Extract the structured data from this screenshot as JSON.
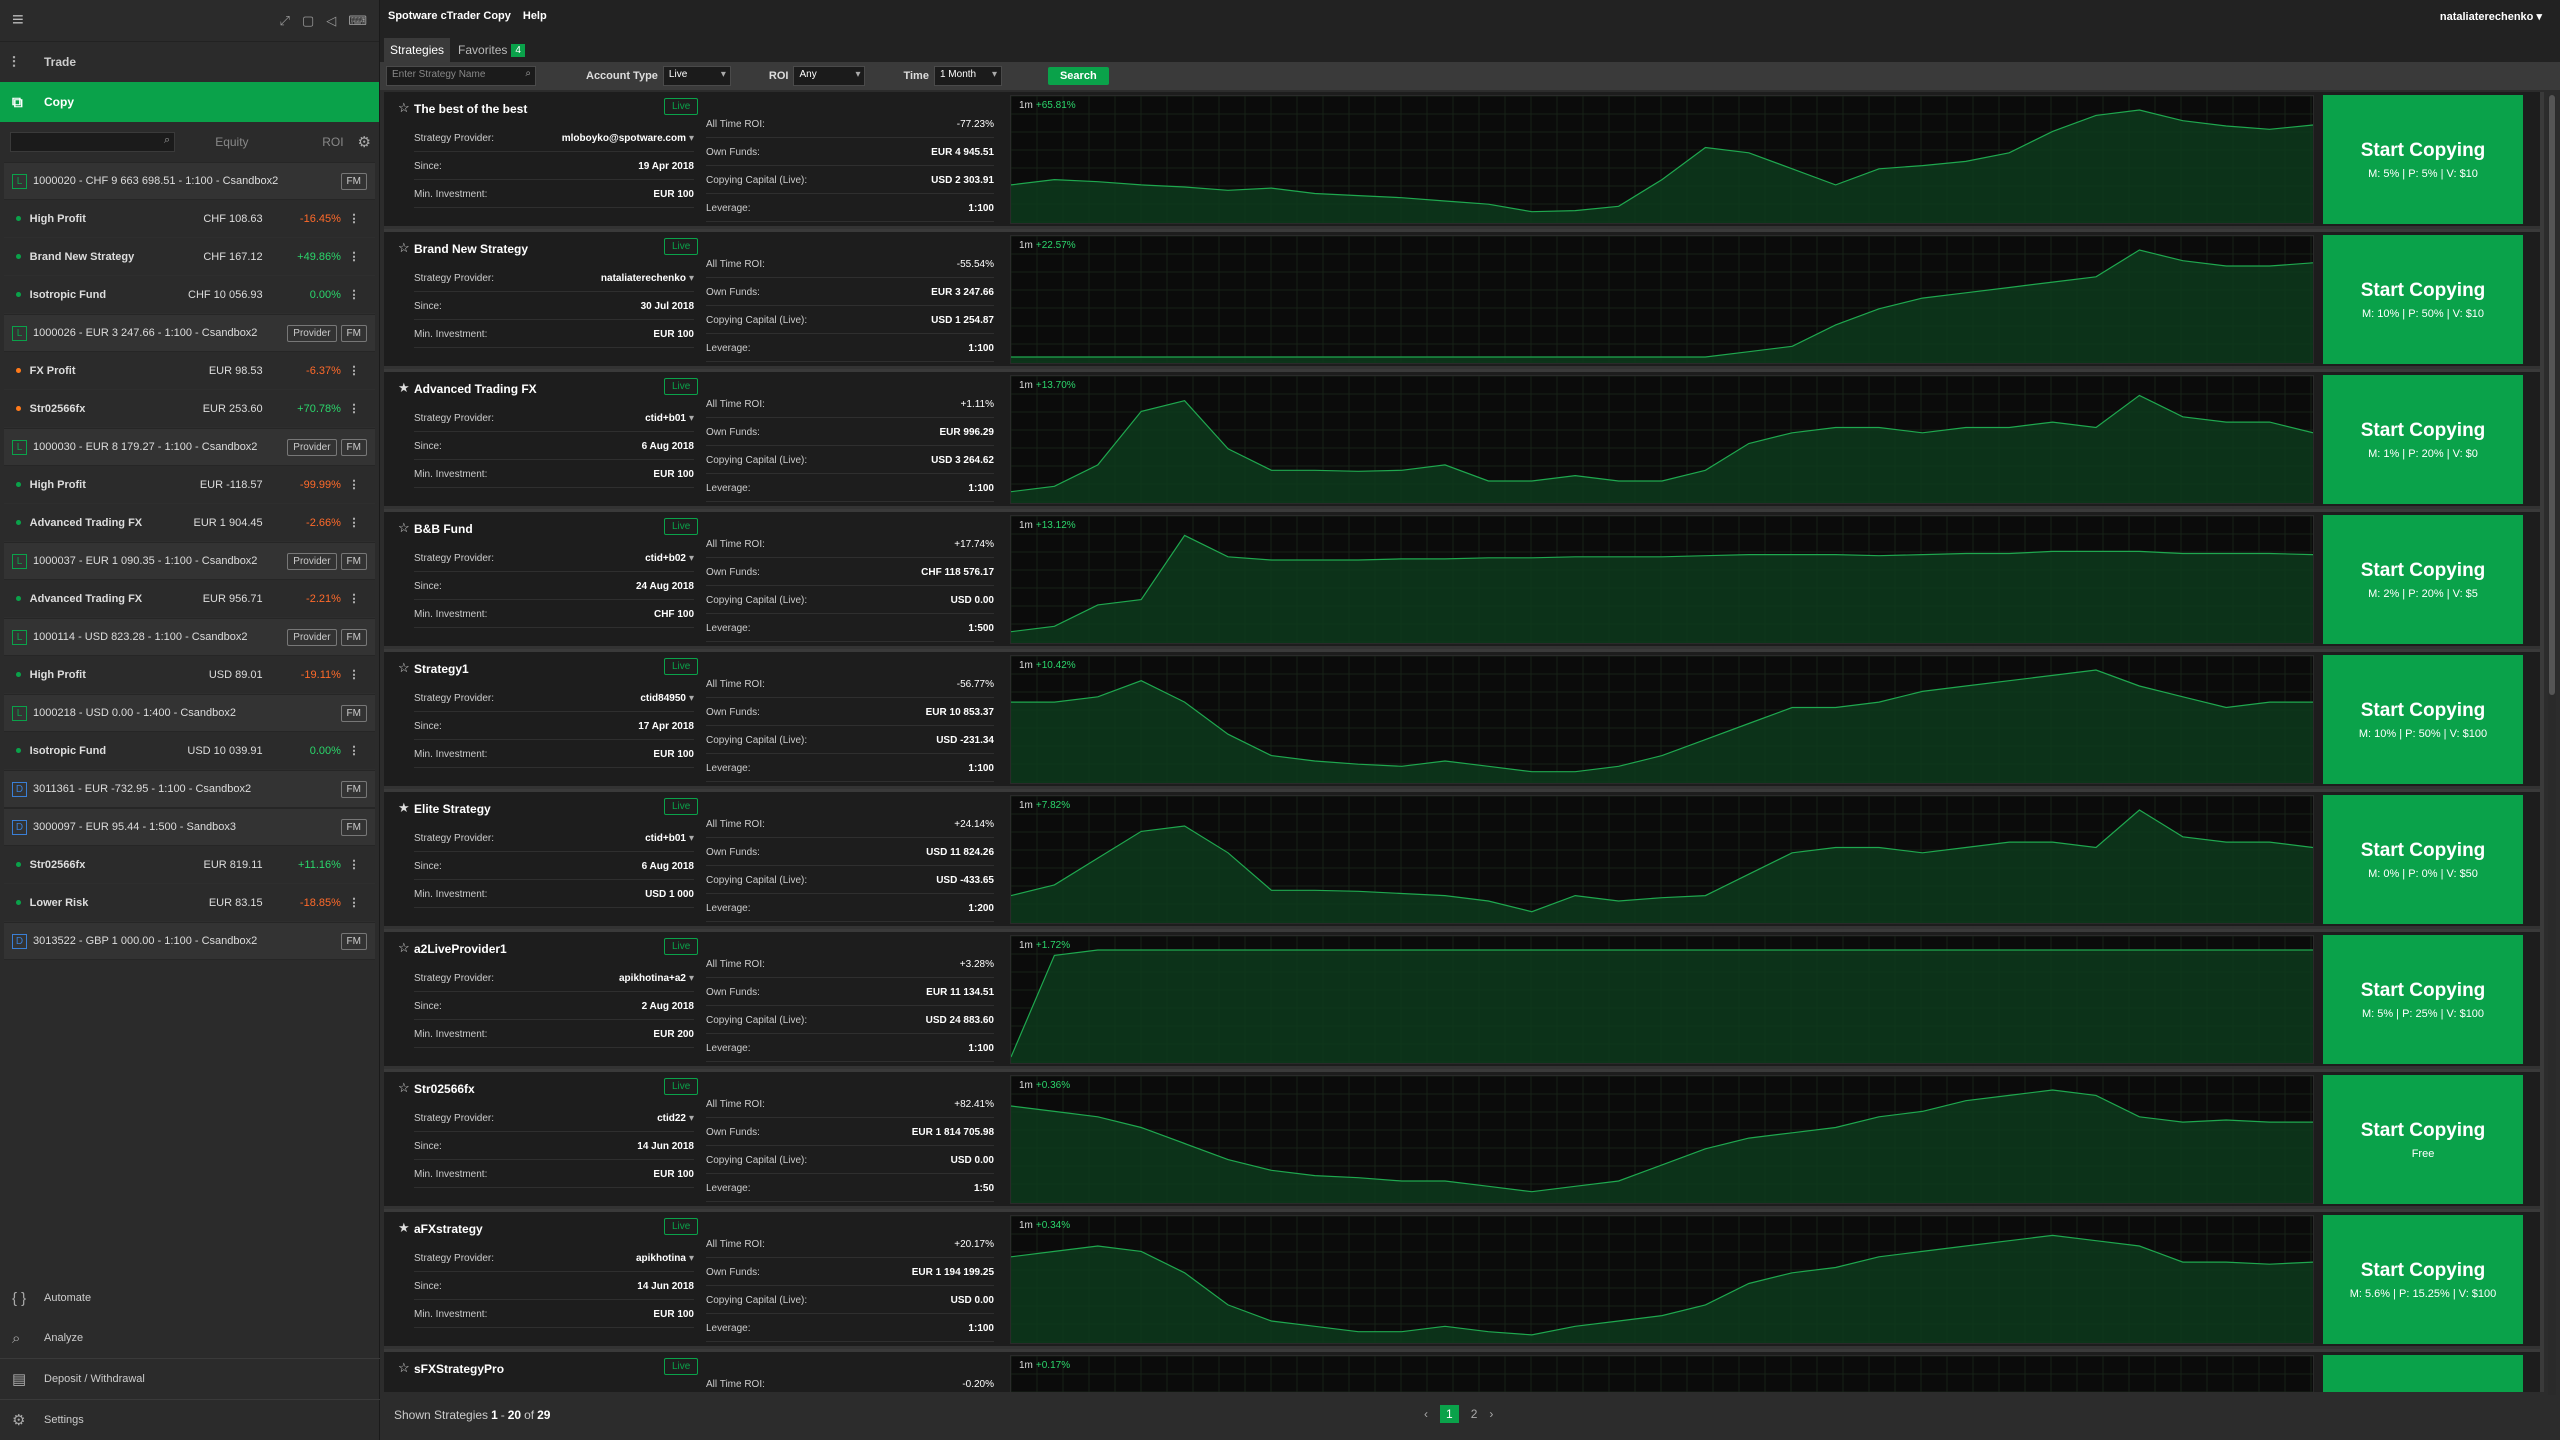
{
  "app": {
    "title": "Spotware cTrader Copy",
    "help": "Help",
    "user": "nataliaterechenko"
  },
  "sidebar": {
    "nav": [
      {
        "label": "Trade",
        "icon": "trade-icon"
      },
      {
        "label": "Copy",
        "icon": "copy-icon"
      }
    ],
    "header": {
      "equity": "Equity",
      "roi": "ROI"
    },
    "items": [
      {
        "kind": "account",
        "badge": "L",
        "label": "1000020 - CHF 9 663 698.51 - 1:100 - Csandbox2",
        "buttons": [
          "FM"
        ]
      },
      {
        "kind": "strategy",
        "dot": "green",
        "name": "High Profit",
        "equity": "CHF 108.63",
        "roi": "-16.45%",
        "roi_sign": "neg"
      },
      {
        "kind": "strategy",
        "dot": "green",
        "name": "Brand New Strategy",
        "equity": "CHF 167.12",
        "roi": "+49.86%",
        "roi_sign": "pos"
      },
      {
        "kind": "strategy",
        "dot": "green",
        "name": "Isotropic Fund",
        "equity": "CHF 10 056.93",
        "roi": "0.00%",
        "roi_sign": "pos"
      },
      {
        "kind": "account",
        "badge": "L",
        "label": "1000026 - EUR 3 247.66 - 1:100 - Csandbox2",
        "buttons": [
          "Provider",
          "FM"
        ]
      },
      {
        "kind": "strategy",
        "dot": "orange",
        "name": "FX Profit",
        "equity": "EUR 98.53",
        "roi": "-6.37%",
        "roi_sign": "neg"
      },
      {
        "kind": "strategy",
        "dot": "orange",
        "name": "Str02566fx",
        "equity": "EUR 253.60",
        "roi": "+70.78%",
        "roi_sign": "pos"
      },
      {
        "kind": "account",
        "badge": "L",
        "label": "1000030 - EUR 8 179.27 - 1:100 - Csandbox2",
        "buttons": [
          "Provider",
          "FM"
        ]
      },
      {
        "kind": "strategy",
        "dot": "green",
        "name": "High Profit",
        "equity": "EUR -118.57",
        "roi": "-99.99%",
        "roi_sign": "neg"
      },
      {
        "kind": "strategy",
        "dot": "green",
        "name": "Advanced Trading FX",
        "equity": "EUR 1 904.45",
        "roi": "-2.66%",
        "roi_sign": "neg"
      },
      {
        "kind": "account",
        "badge": "L",
        "label": "1000037 - EUR 1 090.35 - 1:100 - Csandbox2",
        "buttons": [
          "Provider",
          "FM"
        ]
      },
      {
        "kind": "strategy",
        "dot": "green",
        "name": "Advanced Trading FX",
        "equity": "EUR 956.71",
        "roi": "-2.21%",
        "roi_sign": "neg"
      },
      {
        "kind": "account",
        "badge": "L",
        "label": "1000114 - USD 823.28 - 1:100 - Csandbox2",
        "buttons": [
          "Provider",
          "FM"
        ]
      },
      {
        "kind": "strategy",
        "dot": "green",
        "name": "High Profit",
        "equity": "USD 89.01",
        "roi": "-19.11%",
        "roi_sign": "neg"
      },
      {
        "kind": "account",
        "badge": "L",
        "label": "1000218 - USD 0.00 - 1:400 - Csandbox2",
        "buttons": [
          "FM"
        ]
      },
      {
        "kind": "strategy",
        "dot": "green",
        "name": "Isotropic Fund",
        "equity": "USD 10 039.91",
        "roi": "0.00%",
        "roi_sign": "pos"
      },
      {
        "kind": "account",
        "badge": "D",
        "label": "3011361 - EUR -732.95 - 1:100 - Csandbox2",
        "buttons": [
          "FM"
        ]
      },
      {
        "kind": "account",
        "badge": "D",
        "label": "3000097 - EUR 95.44 - 1:500 - Sandbox3",
        "buttons": [
          "FM"
        ]
      },
      {
        "kind": "strategy",
        "dot": "green",
        "name": "Str02566fx",
        "equity": "EUR 819.11",
        "roi": "+11.16%",
        "roi_sign": "pos"
      },
      {
        "kind": "strategy",
        "dot": "green",
        "name": "Lower Risk",
        "equity": "EUR 83.15",
        "roi": "-18.85%",
        "roi_sign": "neg"
      },
      {
        "kind": "account",
        "badge": "D",
        "label": "3013522 - GBP 1 000.00 - 1:100 - Csandbox2",
        "buttons": [
          "FM"
        ]
      }
    ],
    "bottom": [
      {
        "label": "Automate",
        "icon": "automate-icon"
      },
      {
        "label": "Analyze",
        "icon": "analyze-icon"
      },
      {
        "label": "Deposit / Withdrawal",
        "icon": "deposit-icon"
      },
      {
        "label": "Settings",
        "icon": "settings-icon"
      }
    ]
  },
  "tabs": [
    {
      "label": "Strategies",
      "active": true
    },
    {
      "label": "Favorites",
      "count": "4"
    }
  ],
  "filters": {
    "search_placeholder": "Enter Strategy Name",
    "account_type_label": "Account Type",
    "account_type": "Live",
    "roi_label": "ROI",
    "roi": "Any",
    "time_label": "Time",
    "time": "1 Month",
    "search_btn": "Search"
  },
  "labels": {
    "provider": "Strategy Provider:",
    "since": "Since:",
    "min_inv": "Min. Investment:",
    "all_time_roi": "All Time ROI:",
    "own_funds": "Own Funds:",
    "copying_capital": "Copying Capital (Live):",
    "leverage": "Leverage:",
    "start": "Start Copying",
    "live": "Live",
    "period": "1m"
  },
  "strategies": [
    {
      "name": "The best of the best",
      "fav": false,
      "provider": "mloboyko@spotware.com",
      "since": "19 Apr 2018",
      "min_inv": "EUR 100",
      "roi": "-77.23%",
      "roi_sign": "neg",
      "own_funds": "EUR 4 945.51",
      "copying_capital": "USD 2 303.91",
      "leverage": "1:100",
      "period_roi": "+65.81%",
      "fees": "M: 5% | P: 5% | V: $10",
      "series": [
        0.3,
        0.35,
        0.33,
        0.3,
        0.28,
        0.25,
        0.27,
        0.22,
        0.2,
        0.18,
        0.15,
        0.12,
        0.05,
        0.06,
        0.1,
        0.35,
        0.65,
        0.6,
        0.45,
        0.3,
        0.45,
        0.48,
        0.52,
        0.6,
        0.8,
        0.95,
        1.0,
        0.9,
        0.85,
        0.82,
        0.86
      ]
    },
    {
      "name": "Brand New Strategy",
      "fav": false,
      "provider": "nataliaterechenko",
      "since": "30 Jul 2018",
      "min_inv": "EUR 100",
      "roi": "-55.54%",
      "roi_sign": "neg",
      "own_funds": "EUR 3 247.66",
      "copying_capital": "USD 1 254.87",
      "leverage": "1:100",
      "period_roi": "+22.57%",
      "fees": "M: 10% | P: 50% | V: $10",
      "series": [
        0,
        0,
        0,
        0,
        0,
        0,
        0,
        0,
        0,
        0,
        0,
        0,
        0,
        0,
        0,
        0,
        0,
        0.05,
        0.1,
        0.3,
        0.45,
        0.55,
        0.6,
        0.65,
        0.7,
        0.75,
        1.0,
        0.9,
        0.85,
        0.85,
        0.88
      ]
    },
    {
      "name": "Advanced Trading FX",
      "fav": true,
      "provider": "ctid+b01",
      "since": "6 Aug 2018",
      "min_inv": "EUR 100",
      "roi": "+1.11%",
      "roi_sign": "pos",
      "own_funds": "EUR 996.29",
      "copying_capital": "USD 3 264.62",
      "leverage": "1:100",
      "period_roi": "+13.70%",
      "fees": "M: 1% | P: 20% | V: $0",
      "series": [
        0.05,
        0.1,
        0.3,
        0.8,
        0.9,
        0.45,
        0.25,
        0.25,
        0.24,
        0.25,
        0.3,
        0.15,
        0.15,
        0.2,
        0.15,
        0.15,
        0.25,
        0.5,
        0.6,
        0.65,
        0.65,
        0.6,
        0.65,
        0.65,
        0.7,
        0.65,
        0.95,
        0.75,
        0.7,
        0.7,
        0.6
      ]
    },
    {
      "name": "B&B Fund",
      "fav": false,
      "provider": "ctid+b02",
      "since": "24 Aug 2018",
      "min_inv": "CHF 100",
      "roi": "+17.74%",
      "roi_sign": "pos",
      "own_funds": "CHF 118 576.17",
      "copying_capital": "USD 0.00",
      "leverage": "1:500",
      "period_roi": "+13.12%",
      "fees": "M: 2% | P: 20% | V: $5",
      "series": [
        0.05,
        0.1,
        0.3,
        0.35,
        0.95,
        0.75,
        0.72,
        0.72,
        0.72,
        0.73,
        0.73,
        0.74,
        0.74,
        0.75,
        0.75,
        0.75,
        0.76,
        0.77,
        0.77,
        0.77,
        0.76,
        0.77,
        0.78,
        0.78,
        0.8,
        0.8,
        0.8,
        0.78,
        0.78,
        0.78,
        0.77
      ]
    },
    {
      "name": "Strategy1",
      "fav": false,
      "provider": "ctid84950",
      "since": "17 Apr 2018",
      "min_inv": "EUR 100",
      "roi": "-56.77%",
      "roi_sign": "neg",
      "own_funds": "EUR 10 853.37",
      "copying_capital": "USD -231.34",
      "leverage": "1:100",
      "period_roi": "+10.42%",
      "fees": "M: 10% | P: 50% | V: $100",
      "series": [
        0.7,
        0.7,
        0.75,
        0.9,
        0.7,
        0.4,
        0.2,
        0.15,
        0.12,
        0.1,
        0.15,
        0.1,
        0.05,
        0.05,
        0.1,
        0.2,
        0.35,
        0.5,
        0.65,
        0.65,
        0.7,
        0.8,
        0.85,
        0.9,
        0.95,
        1.0,
        0.85,
        0.75,
        0.65,
        0.7,
        0.7
      ]
    },
    {
      "name": "Elite Strategy",
      "fav": true,
      "provider": "ctid+b01",
      "since": "6 Aug 2018",
      "min_inv": "USD 1 000",
      "roi": "+24.14%",
      "roi_sign": "pos",
      "own_funds": "USD 11 824.26",
      "copying_capital": "USD -433.65",
      "leverage": "1:200",
      "period_roi": "+7.82%",
      "fees": "M: 0% | P: 0% | V: $50",
      "series": [
        0.2,
        0.3,
        0.55,
        0.8,
        0.85,
        0.6,
        0.25,
        0.25,
        0.24,
        0.22,
        0.2,
        0.15,
        0.05,
        0.2,
        0.15,
        0.18,
        0.2,
        0.4,
        0.6,
        0.65,
        0.65,
        0.6,
        0.65,
        0.7,
        0.7,
        0.65,
        1.0,
        0.75,
        0.7,
        0.7,
        0.65
      ]
    },
    {
      "name": "a2LiveProvider1",
      "fav": false,
      "provider": "apikhotina+a2",
      "since": "2 Aug 2018",
      "min_inv": "EUR 200",
      "roi": "+3.28%",
      "roi_sign": "pos",
      "own_funds": "EUR 11 134.51",
      "copying_capital": "USD 24 883.60",
      "leverage": "1:100",
      "period_roi": "+1.72%",
      "fees": "M: 5% | P: 25% | V: $100",
      "series": [
        0.0,
        0.95,
        1.0,
        1.0,
        1.0,
        1.0,
        1.0,
        1.0,
        1.0,
        1.0,
        1.0,
        1.0,
        1.0,
        1.0,
        1.0,
        1.0,
        1.0,
        1.0,
        1.0,
        1.0,
        1.0,
        1.0,
        1.0,
        1.0,
        1.0,
        1.0,
        1.0,
        1.0,
        1.0,
        1.0,
        1.0
      ]
    },
    {
      "name": "Str02566fx",
      "fav": false,
      "provider": "ctid22",
      "since": "14 Jun 2018",
      "min_inv": "EUR 100",
      "roi": "+82.41%",
      "roi_sign": "pos",
      "own_funds": "EUR 1 814 705.98",
      "copying_capital": "USD 0.00",
      "leverage": "1:50",
      "period_roi": "+0.36%",
      "fees": "Free",
      "series": [
        0.85,
        0.8,
        0.75,
        0.65,
        0.5,
        0.35,
        0.25,
        0.2,
        0.18,
        0.15,
        0.15,
        0.1,
        0.05,
        0.1,
        0.15,
        0.3,
        0.45,
        0.55,
        0.6,
        0.65,
        0.75,
        0.8,
        0.9,
        0.95,
        1.0,
        0.95,
        0.75,
        0.7,
        0.72,
        0.7,
        0.7
      ]
    },
    {
      "name": "aFXstrategy",
      "fav": true,
      "provider": "apikhotina",
      "since": "14 Jun 2018",
      "min_inv": "EUR 100",
      "roi": "+20.17%",
      "roi_sign": "pos",
      "own_funds": "EUR 1 194 199.25",
      "copying_capital": "USD 0.00",
      "leverage": "1:100",
      "period_roi": "+0.34%",
      "fees": "M: 5.6% | P: 15.25% | V: $100",
      "series": [
        0.75,
        0.8,
        0.85,
        0.8,
        0.6,
        0.3,
        0.15,
        0.1,
        0.05,
        0.05,
        0.1,
        0.05,
        0.02,
        0.1,
        0.15,
        0.2,
        0.3,
        0.5,
        0.6,
        0.65,
        0.75,
        0.8,
        0.85,
        0.9,
        0.95,
        0.9,
        0.85,
        0.7,
        0.7,
        0.68,
        0.7
      ]
    },
    {
      "name": "sFXStrategyPro",
      "fav": false,
      "provider": "",
      "since": "",
      "min_inv": "",
      "roi": "-0.20%",
      "roi_sign": "neg",
      "own_funds": "",
      "copying_capital": "",
      "leverage": "",
      "period_roi": "+0.17%",
      "fees": "",
      "series": [
        0.5,
        0.5,
        0.5,
        0.5,
        0.5,
        0.5,
        0.5,
        0.5,
        0.5,
        0.5,
        0.5,
        0.5,
        0.5,
        0.5,
        0.5,
        0.5,
        0.5,
        0.5,
        0.5,
        0.5,
        0.5,
        0.5,
        0.5,
        0.5,
        0.5,
        0.5,
        0.5,
        0.5,
        0.5,
        0.5,
        0.5
      ]
    }
  ],
  "footer": {
    "text": "Shown Strategies",
    "range_start": "1",
    "dash": "-",
    "range_end": "20",
    "of": "of",
    "total": "29",
    "pages": [
      "1",
      "2"
    ],
    "prev": "‹",
    "next": "›"
  }
}
